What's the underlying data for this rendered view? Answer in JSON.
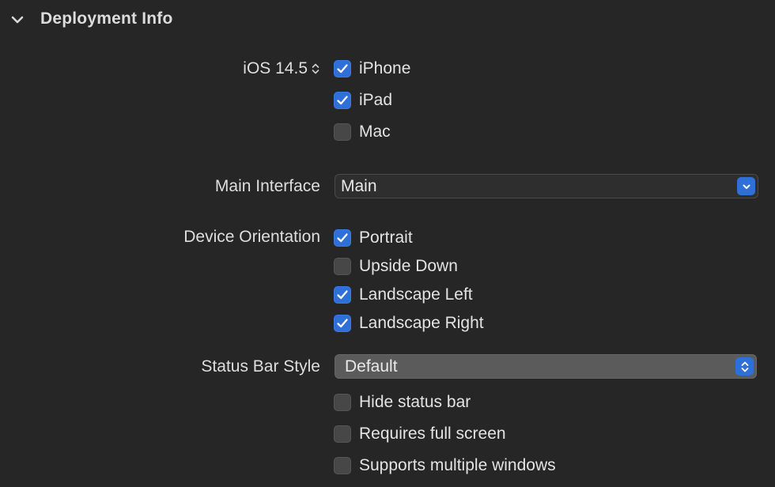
{
  "section": {
    "title": "Deployment Info",
    "disclosure_icon": "chevron-down-icon"
  },
  "deployment_target": {
    "version": "iOS 14.5",
    "icon": "updown-chevron-icon",
    "devices": [
      {
        "label": "iPhone",
        "checked": true
      },
      {
        "label": "iPad",
        "checked": true
      },
      {
        "label": "Mac",
        "checked": false
      }
    ]
  },
  "main_interface": {
    "label": "Main Interface",
    "value": "Main",
    "icon": "chevron-down-icon"
  },
  "device_orientation": {
    "label": "Device Orientation",
    "options": [
      {
        "label": "Portrait",
        "checked": true
      },
      {
        "label": "Upside Down",
        "checked": false
      },
      {
        "label": "Landscape Left",
        "checked": true
      },
      {
        "label": "Landscape Right",
        "checked": true
      }
    ]
  },
  "status_bar": {
    "label": "Status Bar Style",
    "value": "Default",
    "icon": "updown-chevron-icon",
    "options": [
      {
        "label": "Hide status bar",
        "checked": false
      },
      {
        "label": "Requires full screen",
        "checked": false
      },
      {
        "label": "Supports multiple windows",
        "checked": false
      }
    ]
  },
  "colors": {
    "background": "#262626",
    "accent": "#2f6fd8",
    "checkbox_off": "#474747",
    "text": "#e3e3e3"
  }
}
